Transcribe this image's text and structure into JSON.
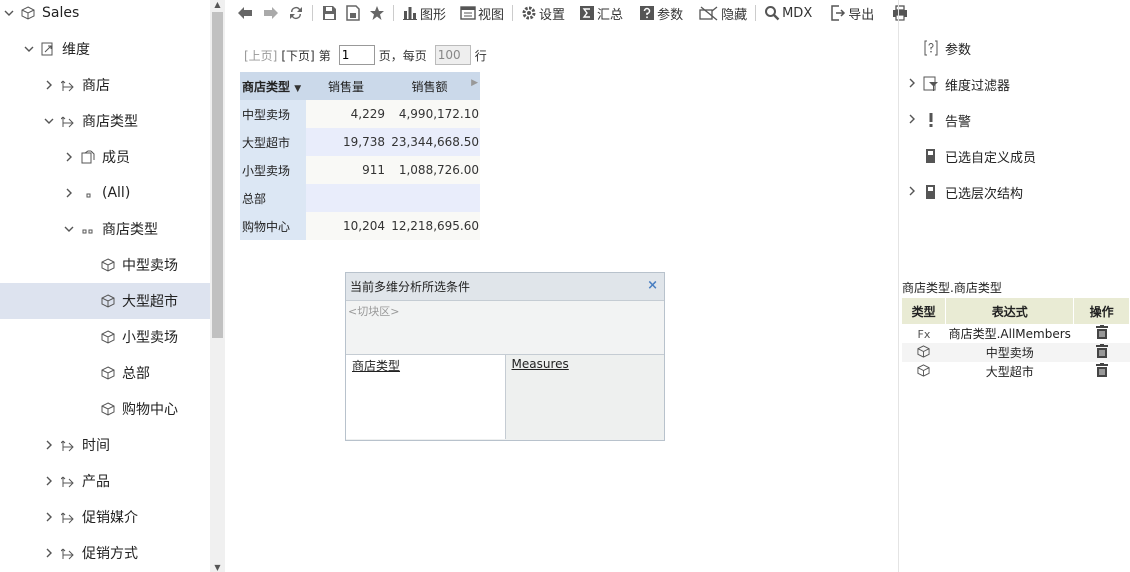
{
  "tree": {
    "items": [
      {
        "label": "Sales",
        "twisty": "chevron-down",
        "icon": "cube",
        "level": 0
      },
      {
        "label": "维度",
        "twisty": "chevron-down",
        "icon": "dimension",
        "level": 1
      },
      {
        "label": "商店",
        "twisty": "chevron-right",
        "icon": "hierarchy",
        "level": 2
      },
      {
        "label": "商店类型",
        "twisty": "chevron-down",
        "icon": "hierarchy",
        "level": 2
      },
      {
        "label": "成员",
        "twisty": "chevron-right",
        "icon": "member-box",
        "level": 3
      },
      {
        "label": "(All)",
        "twisty": "chevron-right",
        "icon": "dot",
        "level": 3
      },
      {
        "label": "商店类型",
        "twisty": "chevron-down",
        "icon": "level-dots",
        "level": 3
      },
      {
        "label": "中型卖场",
        "twisty": "",
        "icon": "cube",
        "level": 4
      },
      {
        "label": "大型超市",
        "twisty": "",
        "icon": "cube",
        "level": 4,
        "selected": true
      },
      {
        "label": "小型卖场",
        "twisty": "",
        "icon": "cube",
        "level": 4
      },
      {
        "label": "总部",
        "twisty": "",
        "icon": "cube",
        "level": 4
      },
      {
        "label": "购物中心",
        "twisty": "",
        "icon": "cube",
        "level": 4
      },
      {
        "label": "时间",
        "twisty": "chevron-right",
        "icon": "hierarchy",
        "level": 2
      },
      {
        "label": "产品",
        "twisty": "chevron-right",
        "icon": "hierarchy",
        "level": 2
      },
      {
        "label": "促销媒介",
        "twisty": "chevron-right",
        "icon": "hierarchy",
        "level": 2
      },
      {
        "label": "促销方式",
        "twisty": "chevron-right",
        "icon": "hierarchy",
        "level": 2
      }
    ]
  },
  "toolbar": {
    "chart": "图形",
    "view": "视图",
    "settings": "设置",
    "summary": "汇总",
    "params": "参数",
    "hide": "隐藏",
    "mdx": "MDX",
    "export": "导出"
  },
  "pager": {
    "prev": "[上页]",
    "next": "[下页]",
    "page_prefix": "第",
    "page_value": "1",
    "page_suffix": "页，每页",
    "page_size": "100",
    "row_suffix": "行"
  },
  "grid": {
    "row_header": "商店类型",
    "measures": [
      "销售量",
      "销售额"
    ],
    "rows": [
      {
        "label": "中型卖场",
        "qty": "4,229",
        "amount": "4,990,172.10"
      },
      {
        "label": "大型超市",
        "qty": "19,738",
        "amount": "23,344,668.50"
      },
      {
        "label": "小型卖场",
        "qty": "911",
        "amount": "1,088,726.00"
      },
      {
        "label": "总部",
        "qty": "",
        "amount": ""
      },
      {
        "label": "购物中心",
        "qty": "10,204",
        "amount": "12,218,695.60"
      }
    ]
  },
  "slicer": {
    "title": "当前多维分析所选条件",
    "close": "×",
    "zone": "<切块区>",
    "rows_axis": "商店类型",
    "cols_axis": "Measures"
  },
  "right_panel": {
    "items": [
      {
        "label": "参数",
        "twisty": "",
        "icon": "param"
      },
      {
        "label": "维度过滤器",
        "twisty": "chevron-right",
        "icon": "filter"
      },
      {
        "label": "告警",
        "twisty": "chevron-right",
        "icon": "alert"
      },
      {
        "label": "已选自定义成员",
        "twisty": "",
        "icon": "doc"
      },
      {
        "label": "已选层次结构",
        "twisty": "chevron-right",
        "icon": "doc"
      }
    ],
    "caption": "商店类型.商店类型",
    "table": {
      "headers": [
        "类型",
        "表达式",
        "操作"
      ],
      "rows": [
        {
          "type": "Fx",
          "expr": "商店类型.AllMembers"
        },
        {
          "type": "cube",
          "expr": "中型卖场"
        },
        {
          "type": "cube",
          "expr": "大型超市"
        }
      ]
    }
  },
  "colors": {
    "selected_row": "#dde3ef",
    "grid_header": "#cbd9ea",
    "grid_row_header": "#dce7f4",
    "table_header": "#e9ebd4"
  }
}
